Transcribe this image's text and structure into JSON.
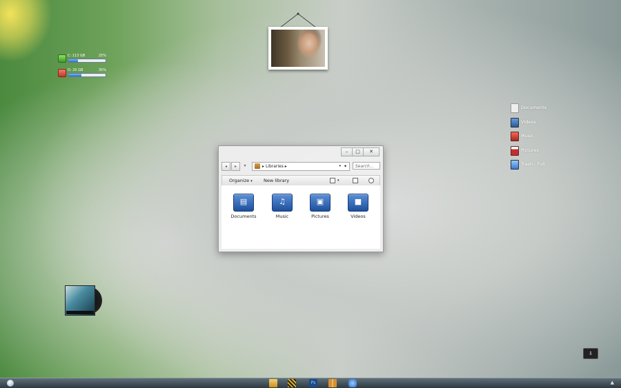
{
  "drives": [
    {
      "label": "C:  113 GB",
      "percent_text": "25%",
      "usage": 0.25,
      "status": "green"
    },
    {
      "label": "D:  20 GB",
      "percent_text": "35%",
      "usage": 0.35,
      "status": "red"
    }
  ],
  "desktop_libraries": [
    {
      "label": "Documents",
      "icon": "documents-icon",
      "color": "#e8e8e8"
    },
    {
      "label": "Videos",
      "icon": "videos-icon",
      "color": "#3a6fa8"
    },
    {
      "label": "Music",
      "icon": "music-icon",
      "color": "#c0392b"
    },
    {
      "label": "Pictures",
      "icon": "pictures-icon",
      "color": "#b03030"
    },
    {
      "label": "Trash - Full",
      "icon": "trash-icon",
      "color": "#4a8ad4"
    }
  ],
  "window": {
    "controls": {
      "minimize": "–",
      "maximize": "□",
      "close": "✕"
    },
    "nav": {
      "back": "◂",
      "forward": "▸",
      "dropdown": "▾"
    },
    "address": {
      "separator": "▸",
      "crumb": "Libraries",
      "crumb_arrow": "▸",
      "dropdown": "▾",
      "refresh": "✦"
    },
    "search_placeholder": "Search...",
    "toolbar": {
      "organize": "Organize",
      "organize_arrow": "▾",
      "new_library": "New library",
      "view_arrow": "▾"
    },
    "folders": [
      {
        "name": "Documents",
        "icon": "documents-folder-icon",
        "glyph": "▤"
      },
      {
        "name": "Music",
        "icon": "music-folder-icon",
        "glyph": "♫"
      },
      {
        "name": "Pictures",
        "icon": "pictures-folder-icon",
        "glyph": "▣"
      },
      {
        "name": "Videos",
        "icon": "videos-folder-icon",
        "glyph": "■"
      }
    ]
  },
  "taskbar": {
    "items": [
      {
        "name": "explorer-icon",
        "color": "#e8c050"
      },
      {
        "name": "media-icon",
        "color": "#e0b020"
      },
      {
        "name": "photoshop-icon",
        "color": "#1e4a8a"
      },
      {
        "name": "library-icon",
        "color": "#d89030"
      },
      {
        "name": "browser-icon",
        "color": "#3a8ad4"
      }
    ],
    "tray_arrow": "▲"
  },
  "accent_colors": {
    "progress_fill": "#1e6fd0",
    "folder_blue": "#1e4f9c"
  }
}
